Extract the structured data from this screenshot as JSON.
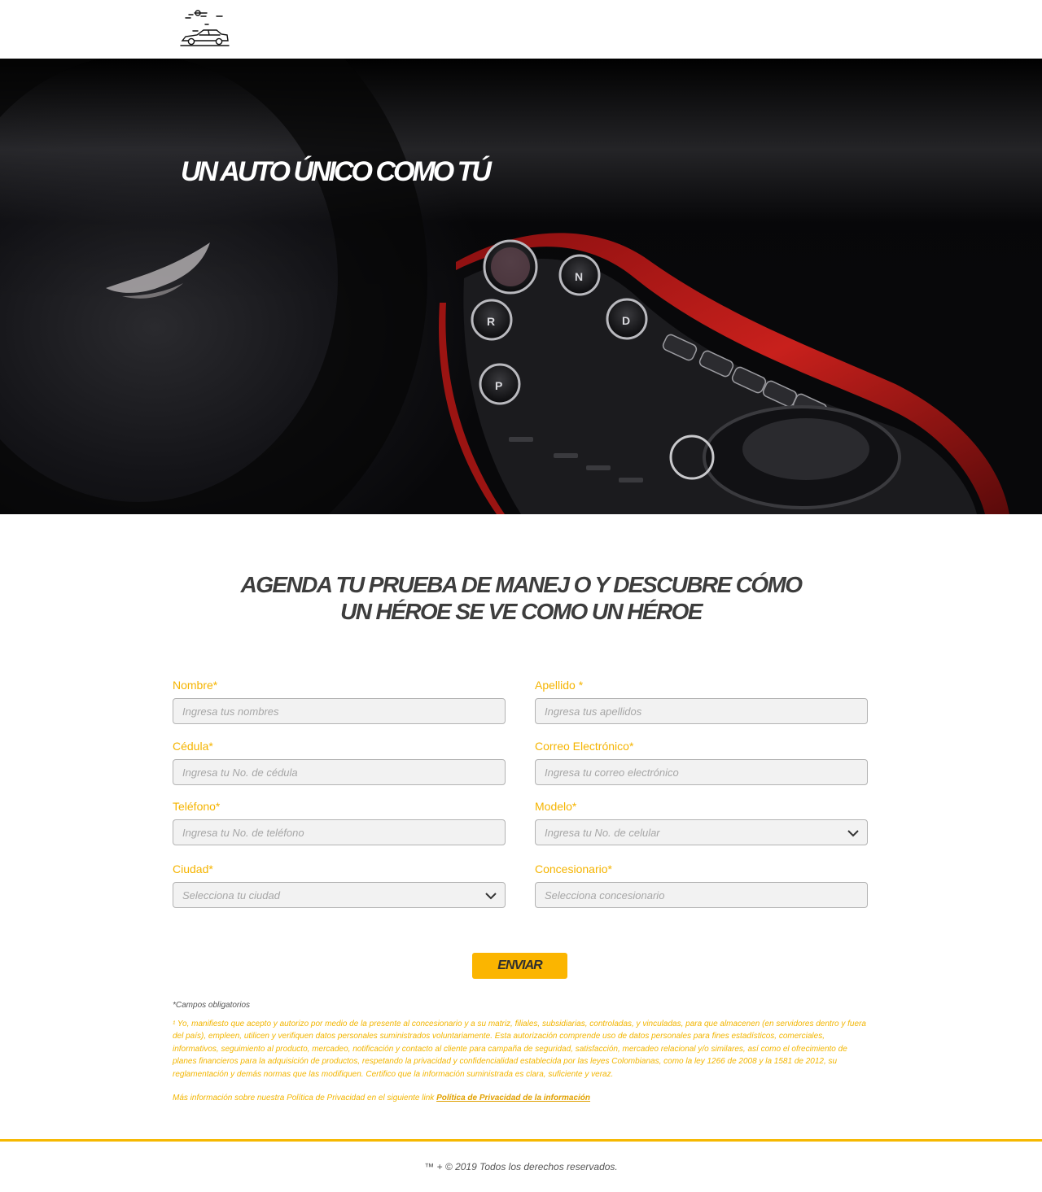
{
  "hero": {
    "title": "UN AUTO ÚNICO COMO TÚ"
  },
  "section": {
    "heading_line1": "AGENDA TU PRUEBA DE MANEJ O Y DESCUBRE CÓMO",
    "heading_line2": "UN HÉROE SE VE COMO UN HÉROE"
  },
  "form": {
    "nombre": {
      "label": "Nombre*",
      "placeholder": "Ingresa tus nombres"
    },
    "apellido": {
      "label": "Apellido *",
      "placeholder": "Ingresa tus apellidos"
    },
    "cedula": {
      "label": "Cédula*",
      "placeholder": "Ingresa tu No. de cédula"
    },
    "correo": {
      "label": "Correo Electrónico*",
      "placeholder": "Ingresa tu correo electrónico"
    },
    "telefono": {
      "label": "Teléfono*",
      "placeholder": "Ingresa tu No. de teléfono"
    },
    "modelo": {
      "label": "Modelo*",
      "placeholder": "Ingresa tu No. de celular"
    },
    "ciudad": {
      "label": "Ciudad*",
      "placeholder": "Selecciona tu ciudad"
    },
    "concesionario": {
      "label": "Concesionario*",
      "placeholder": "Selecciona concesionario"
    },
    "submit_label": "ENVIAR"
  },
  "notes": {
    "required": "*Campos obligatorios",
    "consent": "¹ Yo, manifiesto que acepto y autorizo por medio de la presente al concesionario y a su matriz, filiales, subsidiarias, controladas, y vinculadas, para que almacenen (en servidores dentro y fuera del país), empleen, utilicen y verifiquen datos personales suministrados voluntariamente. Esta autorización comprende uso de datos personales para fines estadísticos, comerciales, informativos, seguimiento al producto, mercadeo, notificación y contacto al cliente para campaña de seguridad, satisfacción, mercadeo relacional y/o similares, así como el ofrecimiento de planes financieros para la adquisición de productos, respetando la privacidad y confidencialidad establecida por las leyes Colombianas, como la ley 1266 de 2008 y la 1581 de 2012, su reglamentación y demás normas que las modifiquen. Certifico que la información suministrada es clara, suficiente y veraz.",
    "privacy_prefix": "Más información sobre nuestra Política de Privacidad en el siguiente link",
    "privacy_link": "Política de Privacidad de la información"
  },
  "footer": {
    "text": "™ + © 2019 Todos los derechos reservados."
  },
  "colors": {
    "accent": "#f5b400",
    "button": "#fbb500",
    "heading": "#3d3d3d"
  },
  "icons": {
    "logo": "delorean-car-logo-icon",
    "chevron": "chevron-down-icon"
  }
}
